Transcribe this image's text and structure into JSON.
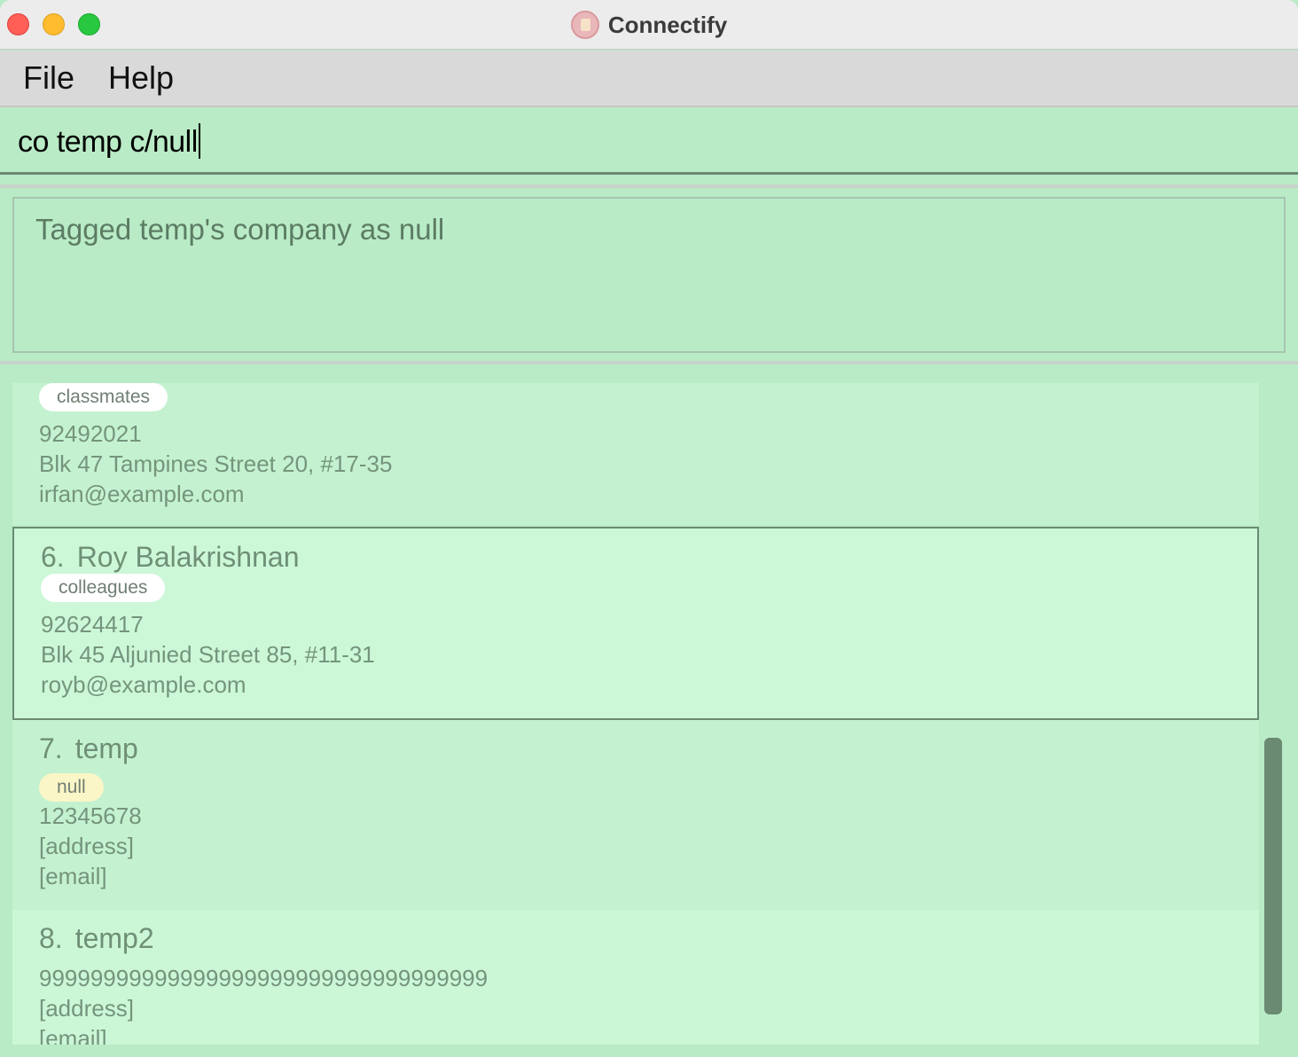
{
  "window": {
    "title": "Connectify"
  },
  "menu": {
    "file": "File",
    "help": "Help"
  },
  "command": {
    "value": "co temp c/null"
  },
  "result": {
    "message": "Tagged temp's company as null"
  },
  "persons": [
    {
      "index": "",
      "name": "",
      "tag": "classmates",
      "phone": "92492021",
      "address": "Blk 47 Tampines Street 20, #17-35",
      "email": "irfan@example.com"
    },
    {
      "index": "6.",
      "name": "Roy Balakrishnan",
      "tag": "colleagues",
      "phone": "92624417",
      "address": "Blk 45 Aljunied Street 85, #11-31",
      "email": "royb@example.com"
    },
    {
      "index": "7.",
      "name": "temp",
      "tag": "null",
      "phone": "12345678",
      "address": "[address]",
      "email": "[email]"
    },
    {
      "index": "8.",
      "name": "temp2",
      "phone": "99999999999999999999999999999999999",
      "address": "[address]",
      "email": "[email]"
    }
  ]
}
